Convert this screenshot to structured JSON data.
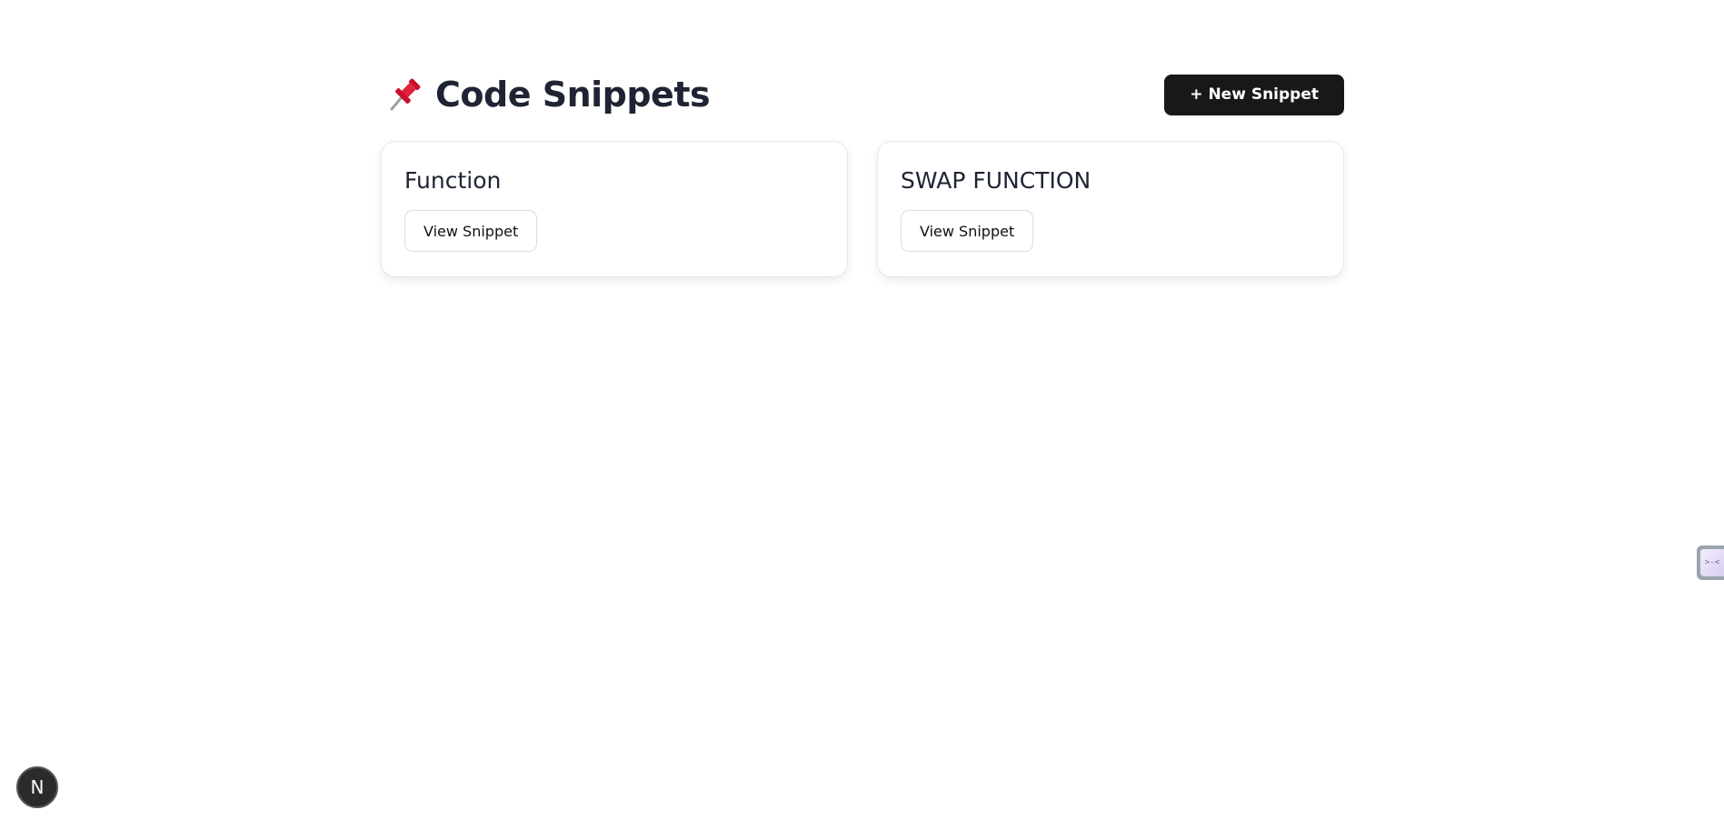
{
  "header": {
    "title": "Code Snippets",
    "pin_icon": "pushpin-icon",
    "new_button_label": "+ New Snippet"
  },
  "snippets": [
    {
      "title": "Function",
      "button_label": "View Snippet"
    },
    {
      "title": "SWAP FUNCTION",
      "button_label": "View Snippet"
    }
  ],
  "dev_badge": {
    "label": "N",
    "icon": "nextjs-logo-icon"
  },
  "side_widget": {
    "label": ">-<",
    "icon": "devtools-widget-icon"
  },
  "colors": {
    "primary_button": "#18181b",
    "title_text": "#1e2433",
    "card_border": "#e5e7eb",
    "pin_red": "#e0243b"
  }
}
